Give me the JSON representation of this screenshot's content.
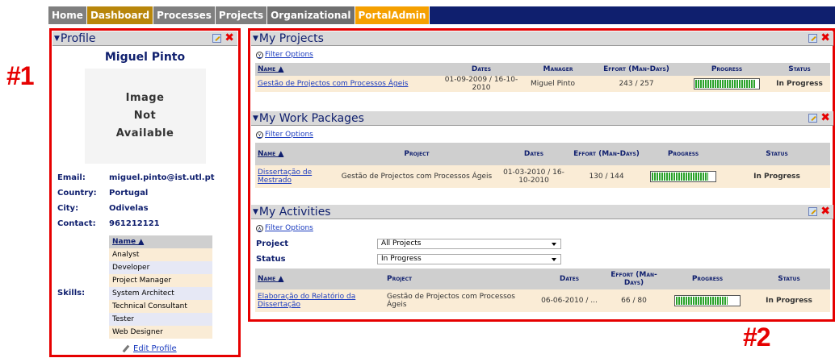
{
  "nav": {
    "tabs": [
      "Home",
      "Dashboard",
      "Processes",
      "Projects",
      "Organizational",
      "PortalAdmin"
    ]
  },
  "annotations": {
    "one": "#1",
    "two": "#2"
  },
  "profile": {
    "title": "Profile",
    "name": "Miguel Pinto",
    "photo_text": [
      "Image",
      "Not",
      "Available"
    ],
    "email_label": "Email:",
    "email": "miguel.pinto@ist.utl.pt",
    "country_label": "Country:",
    "country": "Portugal",
    "city_label": "City:",
    "city": "Odivelas",
    "contact_label": "Contact:",
    "contact": "961212121",
    "skills_label": "Skills:",
    "skills_header": "Name ▲",
    "skills": [
      "Analyst",
      "Developer",
      "Project Manager",
      "System Architect",
      "Technical Consultant",
      "Tester",
      "Web Designer"
    ],
    "edit_link": "Edit Profile"
  },
  "projects": {
    "title": "My Projects",
    "filter": "Filter Options",
    "headers": {
      "name": "Name ▲",
      "dates": "Dates",
      "manager": "Manager",
      "effort": "Effort (Man-Days)",
      "progress": "Progress",
      "status": "Status"
    },
    "row": {
      "name": "Gestão de Projectos com Processos Ágeis",
      "dates": "01-09-2009 / 16-10-2010",
      "manager": "Miguel Pinto",
      "effort": "243 / 257",
      "progress": 0.95,
      "status": "In Progress"
    }
  },
  "workpackages": {
    "title": "My Work Packages",
    "filter": "Filter Options",
    "headers": {
      "name": "Name ▲",
      "project": "Project",
      "dates": "Dates",
      "effort": "Effort (Man-Days)",
      "progress": "Progress",
      "status": "Status"
    },
    "row": {
      "name": "Dissertação de Mestrado",
      "project": "Gestão de Projectos com Processos Ágeis",
      "dates": "01-03-2010 / 16-10-2010",
      "effort": "130 / 144",
      "progress": 0.9,
      "status": "In Progress"
    }
  },
  "activities": {
    "title": "My Activities",
    "filter": "Filter Options",
    "project_label": "Project",
    "project_value": "All Projects",
    "status_label": "Status",
    "status_value": "In Progress",
    "headers": {
      "name": "Name ▲",
      "project": "Project",
      "dates": "Dates",
      "effort": "Effort (Man-Days)",
      "progress": "Progress",
      "status": "Status"
    },
    "row": {
      "name": "Elaboração do Relatório da Dissertação",
      "project": "Gestão de Projectos com Processos Ágeis",
      "dates": "06-06-2010 / ...",
      "effort": "66 / 80",
      "progress": 0.82,
      "status": "In Progress"
    }
  },
  "colors": {
    "nav_bg": "#0f1f6e",
    "accent_red": "#e60000",
    "status": "#d79a00",
    "row_bg": "#faecd6"
  }
}
